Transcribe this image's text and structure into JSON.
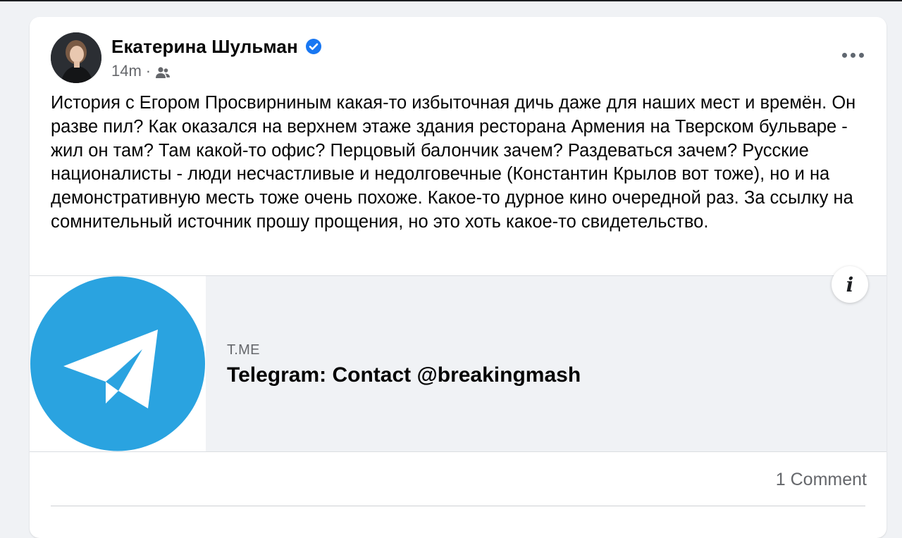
{
  "post": {
    "author_name": "Екатерина Шульман",
    "timestamp": "14m",
    "separator": "·",
    "audience_icon": "friends-icon",
    "verified_icon": "verified-badge-icon",
    "more_icon": "more-options-icon",
    "text": "История с Егором Просвирниным какая-то избыточная дичь даже для наших мест и времён. Он разве пил? Как оказался на верхнем этаже здания ресторана Армения на Тверском бульваре - жил он там? Там какой-то офис? Перцовый балончик зачем? Раздеваться зачем? Русские националисты - люди несчастливые и недолговечные (Константин Крылов вот тоже), но и на демонстративную месть тоже очень похоже. Какое-то дурное кино очередной раз. За ссылку на сомнительный источник прошу прощения, но это хоть какое-то свидетельство."
  },
  "link_preview": {
    "domain": "T.ME",
    "title": "Telegram: Contact @breakingmash",
    "thumbnail_icon": "telegram-logo-icon",
    "info_icon": "info-icon",
    "info_label": "i"
  },
  "footer": {
    "comments_label": "1 Comment"
  },
  "colors": {
    "background": "#f0f2f5",
    "card": "#ffffff",
    "verified": "#1877f2",
    "telegram": "#2aa3e0",
    "secondary_text": "#65676b"
  }
}
